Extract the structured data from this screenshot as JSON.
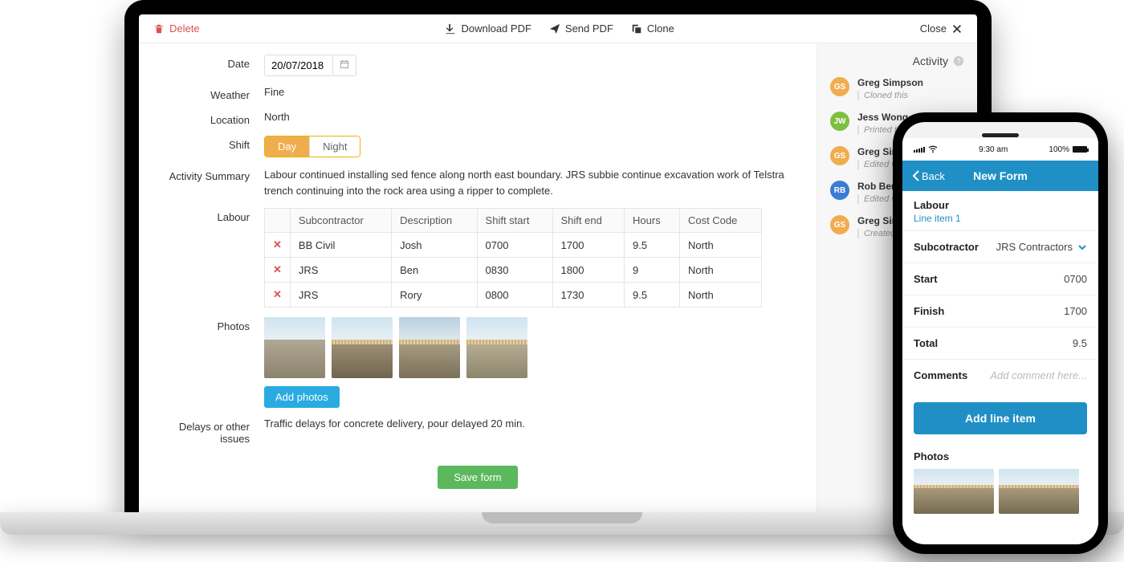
{
  "toolbar": {
    "delete_label": "Delete",
    "download_pdf_label": "Download PDF",
    "send_pdf_label": "Send PDF",
    "clone_label": "Clone",
    "close_label": "Close"
  },
  "form": {
    "date_label": "Date",
    "date_value": "20/07/2018",
    "weather_label": "Weather",
    "weather_value": "Fine",
    "location_label": "Location",
    "location_value": "North",
    "shift_label": "Shift",
    "shift_options": {
      "day": "Day",
      "night": "Night"
    },
    "activity_summary_label": "Activity Summary",
    "activity_summary_value": "Labour continued installing sed fence along north east boundary.  JRS subbie continue excavation work of Telstra trench continuing into the rock area using a ripper to complete.",
    "labour_label": "Labour",
    "labour_headers": [
      "Subcontractor",
      "Description",
      "Shift start",
      "Shift end",
      "Hours",
      "Cost Code"
    ],
    "labour_rows": [
      {
        "sub": "BB Civil",
        "desc": "Josh",
        "start": "0700",
        "end": "1700",
        "hours": "9.5",
        "cost": "North"
      },
      {
        "sub": "JRS",
        "desc": "Ben",
        "start": "0830",
        "end": "1800",
        "hours": "9",
        "cost": "North"
      },
      {
        "sub": "JRS",
        "desc": "Rory",
        "start": "0800",
        "end": "1730",
        "hours": "9.5",
        "cost": "North"
      }
    ],
    "photos_label": "Photos",
    "add_photos_label": "Add photos",
    "delays_label": "Delays or other issues",
    "delays_value": "Traffic delays for concrete delivery, pour delayed 20 min.",
    "save_label": "Save form"
  },
  "activity": {
    "title": "Activity",
    "items": [
      {
        "initials": "GS",
        "color": "orange",
        "name": "Greg Simpson",
        "action": "Cloned this"
      },
      {
        "initials": "JW",
        "color": "green",
        "name": "Jess Wong",
        "action": "Printed this"
      },
      {
        "initials": "GS",
        "color": "orange",
        "name": "Greg Simpson",
        "action": "Edited v3"
      },
      {
        "initials": "RB",
        "color": "blue",
        "name": "Rob Bennett",
        "action": "Edited v2"
      },
      {
        "initials": "GS",
        "color": "orange",
        "name": "Greg Simpson",
        "action": "Created v1"
      }
    ]
  },
  "phone": {
    "status_time": "9:30 am",
    "status_battery": "100%",
    "back_label": "Back",
    "title": "New Form",
    "section_title": "Labour",
    "section_sub": "Line item 1",
    "rows": {
      "subcontractor_label": "Subcotractor",
      "subcontractor_value": "JRS Contractors",
      "start_label": "Start",
      "start_value": "0700",
      "finish_label": "Finish",
      "finish_value": "1700",
      "total_label": "Total",
      "total_value": "9.5",
      "comments_label": "Comments",
      "comments_placeholder": "Add comment here..."
    },
    "add_line_label": "Add line item",
    "photos_label": "Photos"
  }
}
